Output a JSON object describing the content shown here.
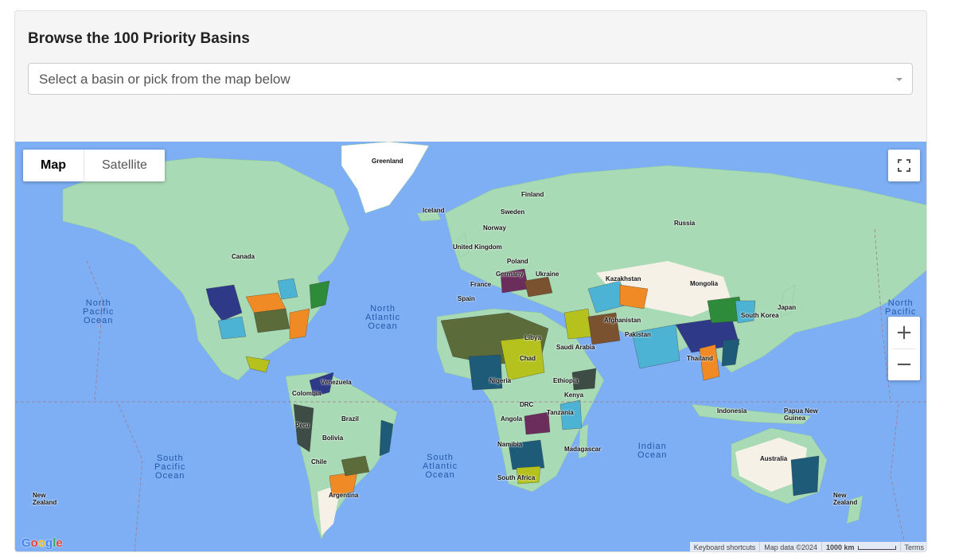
{
  "header": {
    "title": "Browse the 100 Priority Basins"
  },
  "basin_select": {
    "placeholder": "Select a basin or pick from the map below"
  },
  "map_type": {
    "map_label": "Map",
    "satellite_label": "Satellite",
    "selected": "Map"
  },
  "zoom": {
    "in_label": "+",
    "out_label": "−"
  },
  "oceans": {
    "north_pacific_left": "North\nPacific\nOcean",
    "north_atlantic": "North\nAtlantic\nOcean",
    "south_pacific": "South\nPacific\nOcean",
    "south_atlantic": "South\nAtlantic\nOcean",
    "indian": "Indian\nOcean",
    "north_pacific_right": "North\nPacific"
  },
  "countries": {
    "greenland": "Greenland",
    "iceland": "Iceland",
    "finland": "Finland",
    "sweden": "Sweden",
    "norway": "Norway",
    "united_kingdom": "United Kingdom",
    "poland": "Poland",
    "ukraine": "Ukraine",
    "germany": "Germany",
    "france": "France",
    "spain": "Spain",
    "kazakhstan": "Kazakhstan",
    "russia": "Russia",
    "mongolia": "Mongolia",
    "japan": "Japan",
    "south_korea": "South Korea",
    "afghanistan": "Afghanistan",
    "pakistan": "Pakistan",
    "saudi_arabia": "Saudi Arabia",
    "thailand": "Thailand",
    "indonesia": "Indonesia",
    "papua_new_guinea": "Papua New\nGuinea",
    "australia": "Australia",
    "new_zealand_left": "New\nZealand",
    "new_zealand_right": "New\nZealand",
    "canada": "Canada",
    "venezuela": "Venezuela",
    "colombia": "Colombia",
    "peru": "Peru",
    "brazil": "Brazil",
    "bolivia": "Bolivia",
    "chile": "Chile",
    "argentina": "Argentina",
    "libya": "Libya",
    "chad": "Chad",
    "nigeria": "Nigeria",
    "ethiopia": "Ethiopia",
    "kenya": "Kenya",
    "drc": "DRC",
    "tanzania": "Tanzania",
    "angola": "Angola",
    "namibia": "Namibia",
    "madagascar": "Madagascar",
    "south_africa": "South Africa"
  },
  "attribution": {
    "logo": "Google",
    "keyboard_shortcuts": "Keyboard shortcuts",
    "map_data": "Map data ©2024",
    "scale": "1000 km",
    "terms": "Terms"
  },
  "colors": {
    "ocean": "#7eaef3",
    "land": "#a8dab5",
    "land_light": "#f5f1e6",
    "basin_palette": [
      "#2e3a87",
      "#f08a24",
      "#4db3d4",
      "#5c6b3a",
      "#b5c21e",
      "#1d5b79",
      "#6b2d5c",
      "#3d4d45",
      "#7a5230",
      "#2e8b3a"
    ]
  }
}
